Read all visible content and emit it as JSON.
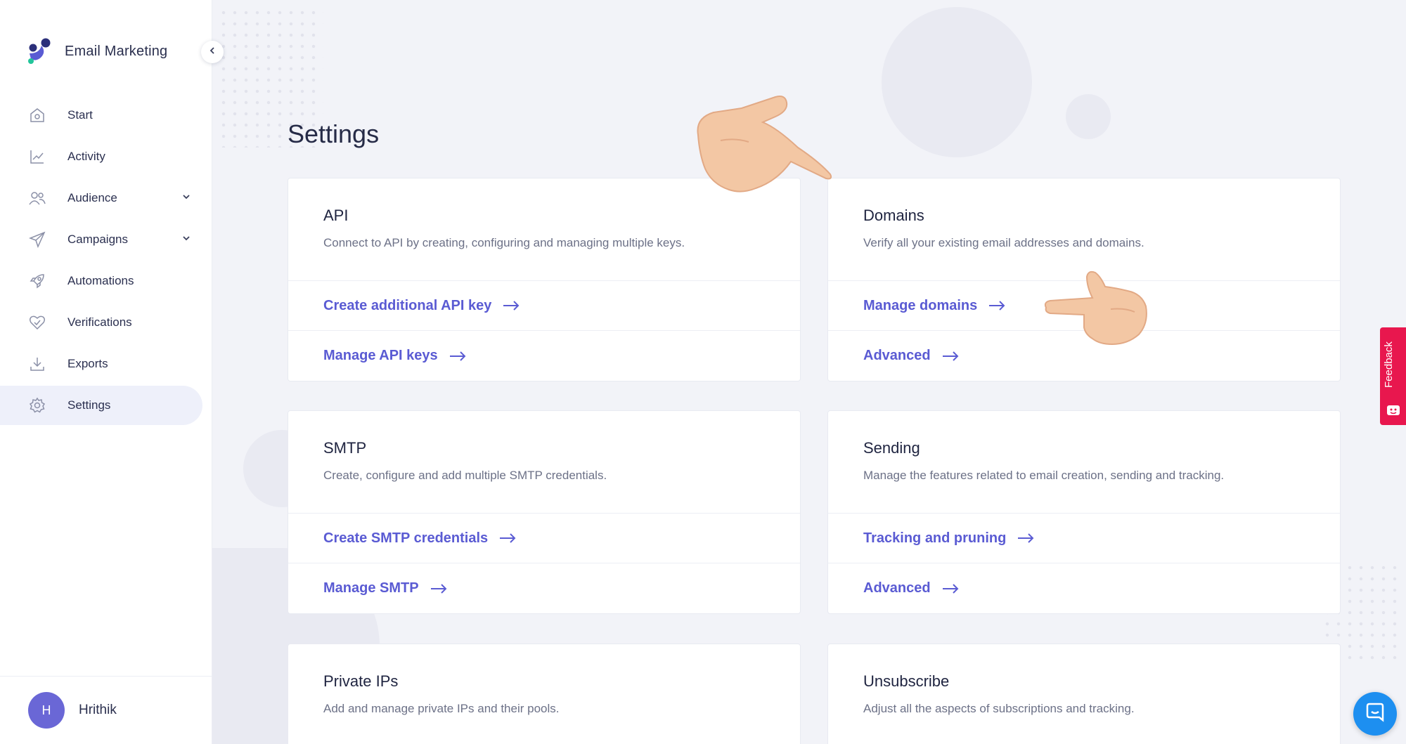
{
  "app": {
    "name": "Email Marketing",
    "brand_colors": [
      "#2b2f7a",
      "#5a5bd3",
      "#22c59a"
    ]
  },
  "sidebar": {
    "items": [
      {
        "label": "Start",
        "icon": "home-icon",
        "active": false,
        "expandable": false
      },
      {
        "label": "Activity",
        "icon": "chart-line-icon",
        "active": false,
        "expandable": false
      },
      {
        "label": "Audience",
        "icon": "users-icon",
        "active": false,
        "expandable": true
      },
      {
        "label": "Campaigns",
        "icon": "paper-plane-icon",
        "active": false,
        "expandable": true
      },
      {
        "label": "Automations",
        "icon": "rocket-icon",
        "active": false,
        "expandable": false
      },
      {
        "label": "Verifications",
        "icon": "heart-check-icon",
        "active": false,
        "expandable": false
      },
      {
        "label": "Exports",
        "icon": "download-icon",
        "active": false,
        "expandable": false
      },
      {
        "label": "Settings",
        "icon": "gear-icon",
        "active": true,
        "expandable": false
      }
    ],
    "user": {
      "initial": "H",
      "name": "Hrithik"
    }
  },
  "main": {
    "title": "Settings",
    "cards": [
      {
        "title": "API",
        "description": "Connect to API by creating, configuring and managing multiple keys.",
        "links": [
          "Create additional API key",
          "Manage API keys"
        ]
      },
      {
        "title": "Domains",
        "description": "Verify all your existing email addresses and domains.",
        "links": [
          "Manage domains",
          "Advanced"
        ]
      },
      {
        "title": "SMTP",
        "description": "Create, configure and add multiple SMTP credentials.",
        "links": [
          "Create SMTP credentials",
          "Manage SMTP"
        ]
      },
      {
        "title": "Sending",
        "description": "Manage the features related to email creation, sending and tracking.",
        "links": [
          "Tracking and pruning",
          "Advanced"
        ]
      },
      {
        "title": "Private IPs",
        "description": "Add and manage private IPs and their pools."
      },
      {
        "title": "Unsubscribe",
        "description": "Adjust all the aspects of subscriptions and tracking."
      }
    ]
  },
  "widgets": {
    "feedback_label": "Feedback",
    "feedback_color": "#e8174e",
    "chat_color": "#1d8ff0",
    "link_color": "#5a5bd3"
  }
}
